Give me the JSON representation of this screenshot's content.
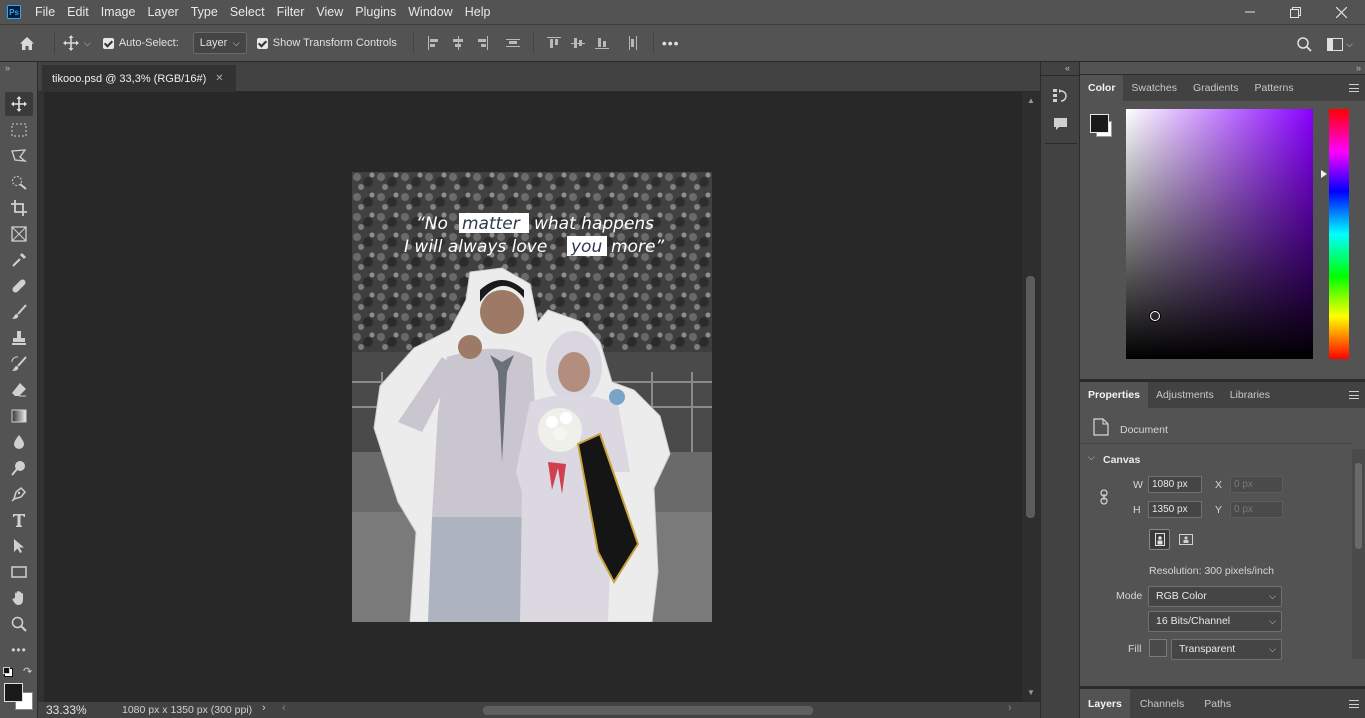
{
  "menu": {
    "items": [
      "File",
      "Edit",
      "Image",
      "Layer",
      "Type",
      "Select",
      "Filter",
      "View",
      "Plugins",
      "Window",
      "Help"
    ],
    "logo": "Ps"
  },
  "options": {
    "auto_select_label": "Auto-Select:",
    "auto_select_value": "Layer",
    "show_transform_label": "Show Transform Controls",
    "more_label": "•••"
  },
  "document": {
    "tab_title": "tikooo.psd @ 33,3% (RGB/16#)",
    "zoom": "33.33%",
    "status_info": "1080 px x 1350 px (300 ppi)"
  },
  "canvas_text": {
    "line1": [
      "“No",
      "matter",
      "what happens"
    ],
    "line2": [
      "I will  always love",
      "you",
      "more”"
    ]
  },
  "color_panel": {
    "tabs": [
      "Color",
      "Swatches",
      "Gradients",
      "Patterns"
    ],
    "active_tab": "Color",
    "foreground": "#1a1a1a",
    "background": "#ffffff",
    "hue_color": "#8800ff"
  },
  "properties_panel": {
    "tabs": [
      "Properties",
      "Adjustments",
      "Libraries"
    ],
    "active_tab": "Properties",
    "type_label": "Document",
    "section_label": "Canvas",
    "w_label": "W",
    "w_value": "1080 px",
    "h_label": "H",
    "h_value": "1350 px",
    "x_label": "X",
    "x_value": "0 px",
    "y_label": "Y",
    "y_value": "0 px",
    "resolution": "Resolution: 300 pixels/inch",
    "mode_label": "Mode",
    "mode_value": "RGB Color",
    "depth_value": "16 Bits/Channel",
    "fill_label": "Fill",
    "fill_value": "Transparent"
  },
  "layers_panel": {
    "tabs": [
      "Layers",
      "Channels",
      "Paths"
    ],
    "active_tab": "Layers"
  }
}
